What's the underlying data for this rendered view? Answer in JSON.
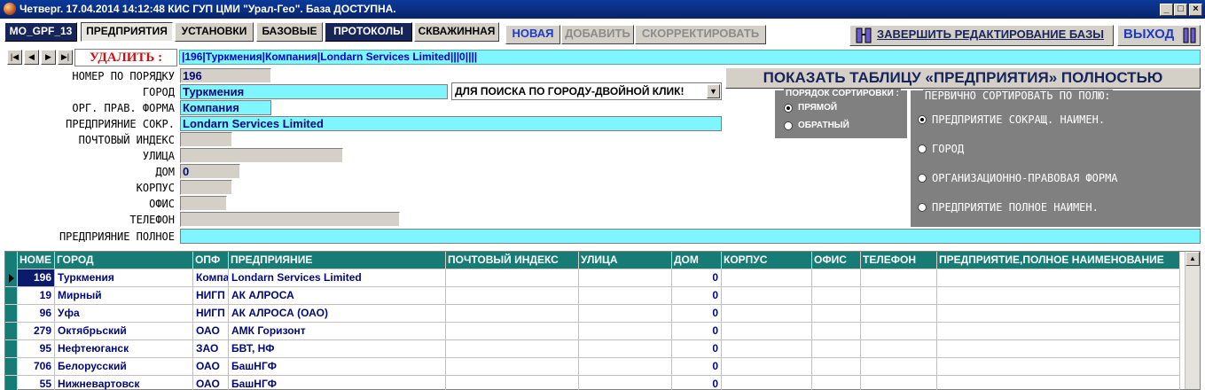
{
  "window": {
    "title": "Четверг. 17.04.2014 14:12:48  КИС ГУП ЦМИ \"Урал-Гео\". База ДОСТУПНА.",
    "minimize": "_",
    "maximize": "□",
    "close": "×"
  },
  "toolbar": {
    "tabs": [
      "MO_GPF_13",
      "ПРЕДПРИЯТИЯ",
      "УСТАНОВКИ",
      "БАЗОВЫЕ",
      "ПРОТОКОЛЫ",
      "СКВАЖИННАЯ"
    ],
    "new_label": "НОВАЯ",
    "add_label": "ДОБАВИТЬ",
    "edit_label": "СКОРРЕКТИРОВАТЬ",
    "finish_label": "ЗАВЕРШИТЬ РЕДАКТИРОВАНИЕ БАЗЫ",
    "exit_label": "ВЫХОД"
  },
  "nav": {
    "first": "|◀",
    "prev": "◀",
    "next": "▶",
    "last": "▶|",
    "delete_label": "УДАЛИТЬ :",
    "record_line": "|196|Туркмения|Компания|Londarn Services Limited|||0||||"
  },
  "form": {
    "labels": {
      "number": "НОМЕР ПО ПОРЯДКУ",
      "city": "ГОРОД",
      "org_form": "ОРГ. ПРАВ. ФОРМА",
      "short_name": "ПРЕДПРИЯНИЕ СОКР.",
      "postal": "ПОЧТОВЫЙ ИНДЕКС",
      "street": "УЛИЦА",
      "house": "ДОМ",
      "building": "КОРПУС",
      "office": "ОФИС",
      "phone": "ТЕЛЕФОН",
      "full_name": "ПРЕДПРИЯНИЕ ПОЛНОЕ"
    },
    "values": {
      "number": "196",
      "city": "Туркмения",
      "org_form": "Компания",
      "short_name": "Londarn Services Limited",
      "postal": "",
      "street": "",
      "house": "0",
      "building": "",
      "office": "",
      "phone": "",
      "full_name": ""
    },
    "city_search": "ДЛЯ ПОИСКА ПО ГОРОДУ-ДВОЙНОЙ КЛИК!",
    "dropdown_arrow": "▼"
  },
  "show_all_label": "ПОКАЗАТЬ ТАБЛИЦУ «ПРЕДПРИЯТИЯ» ПОЛНОСТЬЮ",
  "sort_order": {
    "title": "ПОРЯДОК СОРТИРОВКИ :",
    "options": [
      "ПРЯМОЙ",
      "ОБРАТНЫЙ"
    ],
    "selected": 0
  },
  "sort_field": {
    "title": "ПЕРВИЧНО СОРТИРОВАТЬ ПО ПОЛЮ:",
    "options": [
      "ПРЕДПРИЯТИЕ СОКРАЩ. НАИМЕН.",
      "ГОРОД",
      "ОРГАНИЗАЦИОННО-ПРАВОВАЯ ФОРМА",
      "ПРЕДПРИЯТИЕ ПОЛНОЕ  НАИМЕН."
    ],
    "selected": 0
  },
  "grid": {
    "columns": [
      "НОМЕ",
      "ГОРОД",
      "ОПФ",
      "ПРЕДПРИЯНИЕ",
      "ПОЧТОВЫЙ ИНДЕКС",
      "УЛИЦА",
      "ДОМ",
      "КОРПУС",
      "ОФИС",
      "ТЕЛЕФОН",
      "ПРЕДПРИЯТИЕ,ПОЛНОЕ НАИМЕНОВАНИЕ"
    ],
    "rows": [
      [
        "196",
        "Туркмения",
        "Компа",
        "Londarn Services Limited",
        "",
        "",
        "0",
        "",
        "",
        "",
        ""
      ],
      [
        "19",
        "Мирный",
        "НИГП",
        "АК АЛРОСА",
        "",
        "",
        "0",
        "",
        "",
        "",
        ""
      ],
      [
        "96",
        "Уфа",
        "НИГП",
        "АК АЛРОСА (ОАО)",
        "",
        "",
        "0",
        "",
        "",
        "",
        ""
      ],
      [
        "279",
        "Октябрьский",
        "ОАО",
        "АМК Горизонт",
        "",
        "",
        "0",
        "",
        "",
        "",
        ""
      ],
      [
        "95",
        "Нефтеюганск",
        "ЗАО",
        "БВТ, НФ",
        "",
        "",
        "0",
        "",
        "",
        "",
        ""
      ],
      [
        "706",
        "Белорусский",
        "ОАО",
        "БашНГФ",
        "",
        "",
        "0",
        "",
        "",
        "",
        ""
      ],
      [
        "55",
        "Нижневартовск",
        "ОАО",
        "БашНГФ",
        "",
        "",
        "0",
        "",
        "",
        "",
        ""
      ]
    ],
    "selected_row": 0,
    "scroll_up": "▲"
  }
}
